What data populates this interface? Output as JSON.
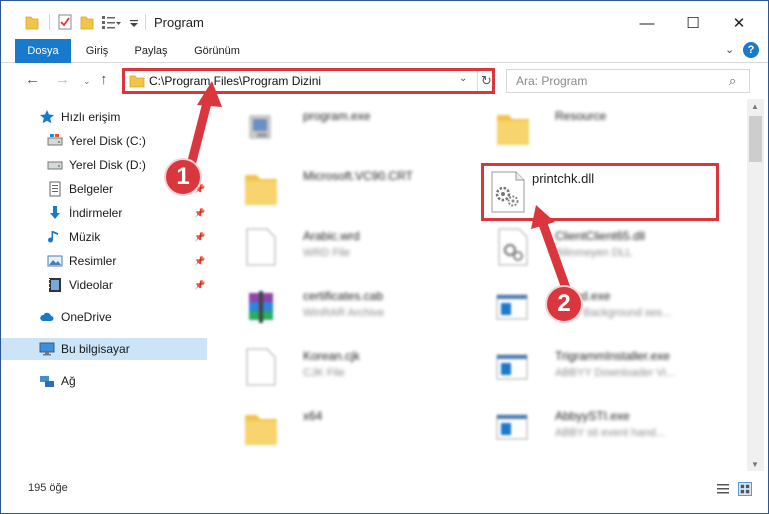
{
  "window": {
    "title": "Program",
    "controls": {
      "minimize": "—",
      "maximize": "☐",
      "close": "✕"
    }
  },
  "ribbon": {
    "tabs": [
      "Dosya",
      "Giriş",
      "Paylaş",
      "Görünüm"
    ],
    "expand": "⌄",
    "help": "?"
  },
  "nav": {
    "back": "←",
    "forward": "→",
    "recent": "⌄",
    "up": "↑",
    "address": "C:\\Program Files\\Program Dizini",
    "address_dropdown": "⌄",
    "refresh": "↻",
    "search_placeholder": "Ara: Program",
    "search_icon": "⌕"
  },
  "sidebar": {
    "items": [
      {
        "label": "Hızlı erişim",
        "icon": "star-icon",
        "pinned": false
      },
      {
        "label": "Yerel Disk (C:)",
        "icon": "drive-icon",
        "pinned": true
      },
      {
        "label": "Yerel Disk (D:)",
        "icon": "drive-icon",
        "pinned": true
      },
      {
        "label": "Belgeler",
        "icon": "documents-icon",
        "pinned": true
      },
      {
        "label": "İndirmeler",
        "icon": "download-icon",
        "pinned": true
      },
      {
        "label": "Müzik",
        "icon": "music-icon",
        "pinned": true
      },
      {
        "label": "Resimler",
        "icon": "pictures-icon",
        "pinned": true
      },
      {
        "label": "Videolar",
        "icon": "video-icon",
        "pinned": true
      },
      {
        "label": "OneDrive",
        "icon": "cloud-icon",
        "pinned": false
      },
      {
        "label": "Bu bilgisayar",
        "icon": "computer-icon",
        "pinned": false,
        "selected": true
      },
      {
        "label": "Ağ",
        "icon": "network-icon",
        "pinned": false
      }
    ],
    "pin_glyph": "📌"
  },
  "files": [
    {
      "name": "program.exe",
      "type": "",
      "icon": "exe-icon"
    },
    {
      "name": "Resource",
      "type": "",
      "icon": "folder-icon"
    },
    {
      "name": "Microsoft.VC90.CRT",
      "type": "",
      "icon": "folder-icon"
    },
    {
      "name": "printchk.dll",
      "type": "",
      "icon": "dll-icon",
      "highlighted": true
    },
    {
      "name": "Arabic.wrd",
      "type": "WRD File",
      "icon": "file-icon"
    },
    {
      "name": "ClientClient65.dll",
      "type": "Bilinmeyen DLL",
      "icon": "dll-icon"
    },
    {
      "name": "certificates.cab",
      "type": "WinRAR Archive",
      "icon": "rar-icon"
    },
    {
      "name": "bkgnd.exe",
      "type": "Abby Background ses...",
      "icon": "exe-icon"
    },
    {
      "name": "Korean.cjk",
      "type": "CJK File",
      "icon": "file-icon"
    },
    {
      "name": "TrigrammInstaller.exe",
      "type": "ABBYY Downloader Vi...",
      "icon": "exe-icon"
    },
    {
      "name": "x64",
      "type": "",
      "icon": "folder-icon"
    },
    {
      "name": "AbbyySTI.exe",
      "type": "ABBY sti event hand...",
      "icon": "exe-icon"
    }
  ],
  "status": {
    "count": "195 öğe"
  },
  "annotations": {
    "callout_1": "1",
    "callout_2": "2"
  },
  "colors": {
    "accent": "#1979ca",
    "highlight": "#d9363e",
    "selected_bg": "#cce4f7",
    "folder": "#f3c44b"
  }
}
